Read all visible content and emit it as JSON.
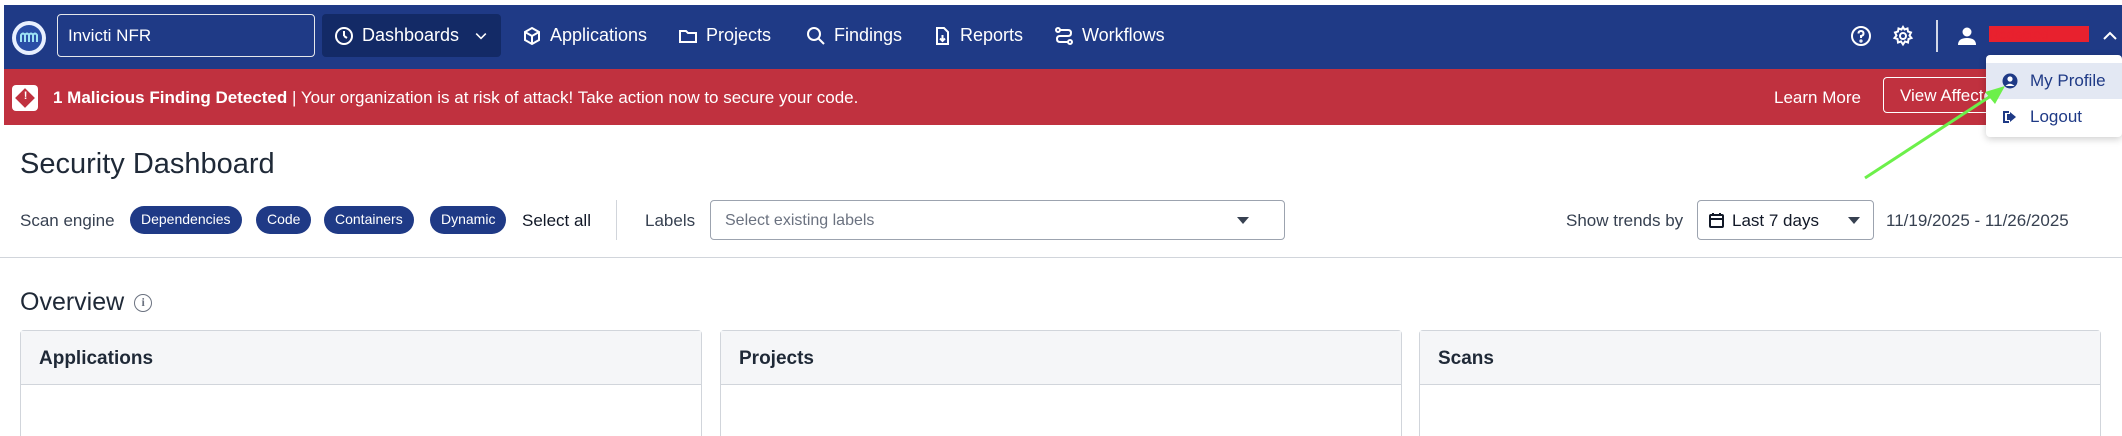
{
  "nav": {
    "org_name": "Invicti NFR",
    "items": [
      {
        "label": "Dashboards",
        "icon": "gauge-icon"
      },
      {
        "label": "Applications",
        "icon": "cube-icon"
      },
      {
        "label": "Projects",
        "icon": "folder-icon"
      },
      {
        "label": "Findings",
        "icon": "search-icon"
      },
      {
        "label": "Reports",
        "icon": "report-icon"
      },
      {
        "label": "Workflows",
        "icon": "workflow-icon"
      }
    ],
    "user_name": "Redacted"
  },
  "alert": {
    "bold_text": "1 Malicious Finding Detected",
    "separator": " | ",
    "message": "Your organization is at risk of attack! Take action now to secure your code.",
    "learn_more": "Learn More",
    "view_affected": "View Affected"
  },
  "user_menu": {
    "items": [
      {
        "label": "My Profile"
      },
      {
        "label": "Logout"
      }
    ]
  },
  "page": {
    "title": "Security Dashboard",
    "scan_engine_label": "Scan engine",
    "scan_engines": [
      "Dependencies",
      "Code",
      "Containers",
      "Dynamic"
    ],
    "select_all": "Select all",
    "labels_label": "Labels",
    "labels_placeholder": "Select existing labels",
    "trends_label": "Show trends by",
    "trend_value": "Last 7 days",
    "date_range": "11/19/2025 - 11/26/2025",
    "overview_title": "Overview",
    "cards": [
      "Applications",
      "Projects",
      "Scans"
    ]
  },
  "colors": {
    "nav_bg": "#1f3a86",
    "alert_bg": "#c0313f",
    "chip_bg": "#1f3a86",
    "arrow": "#6cf04a"
  }
}
